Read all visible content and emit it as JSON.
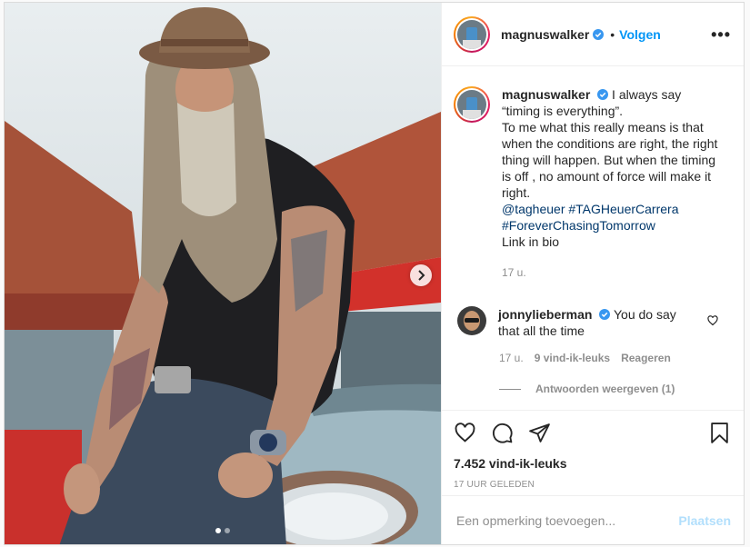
{
  "post": {
    "username": "magnuswalker",
    "separator": "•",
    "follow_label": "Volgen",
    "more_label": "•••",
    "caption_lines": [
      "I always say",
      "“timing is everything”.",
      "To me what this really means is that when the conditions are right, the right thing will happen. But when the timing is off , no amount of force will make it right."
    ],
    "hashtag_line_1": "@tagheuer #TAGHeuerCarrera",
    "hashtag_line_2": "#ForeverChasingTomorrow",
    "caption_tail": "Link in bio",
    "caption_time": "17 u."
  },
  "comment": {
    "username": "jonnylieberman",
    "text": "You do say that all the time",
    "time": "17 u.",
    "likes": "9 vind-ik-leuks",
    "reply_label": "Reageren",
    "view_replies_label": "Antwoorden weergeven (1)"
  },
  "actions": {
    "likes_count": "7.452 vind-ik-leuks",
    "date": "17 UUR GELEDEN"
  },
  "composer": {
    "placeholder": "Een opmerking toevoegen...",
    "post_label": "Plaatsen"
  },
  "carousel": {
    "slide_count": 2,
    "active_slide": 1
  },
  "colors": {
    "accent": "#0095f6",
    "verified": "#3897f0",
    "post_disabled": "#b2dffc",
    "meta_gray": "#8e8e8e"
  }
}
